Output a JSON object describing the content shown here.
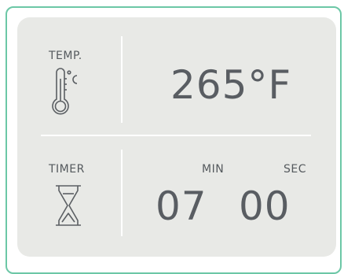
{
  "temperature": {
    "label": "TEMP.",
    "icon": "thermometer-celsius-icon",
    "value": "265°F"
  },
  "timer": {
    "label": "TIMER",
    "icon": "hourglass-icon",
    "min_label": "MIN",
    "sec_label": "SEC",
    "minutes": "07",
    "seconds": "00"
  },
  "colors": {
    "frame_border": "#6cc7a6",
    "panel_bg": "#e8e9e6",
    "text": "#595d62"
  }
}
